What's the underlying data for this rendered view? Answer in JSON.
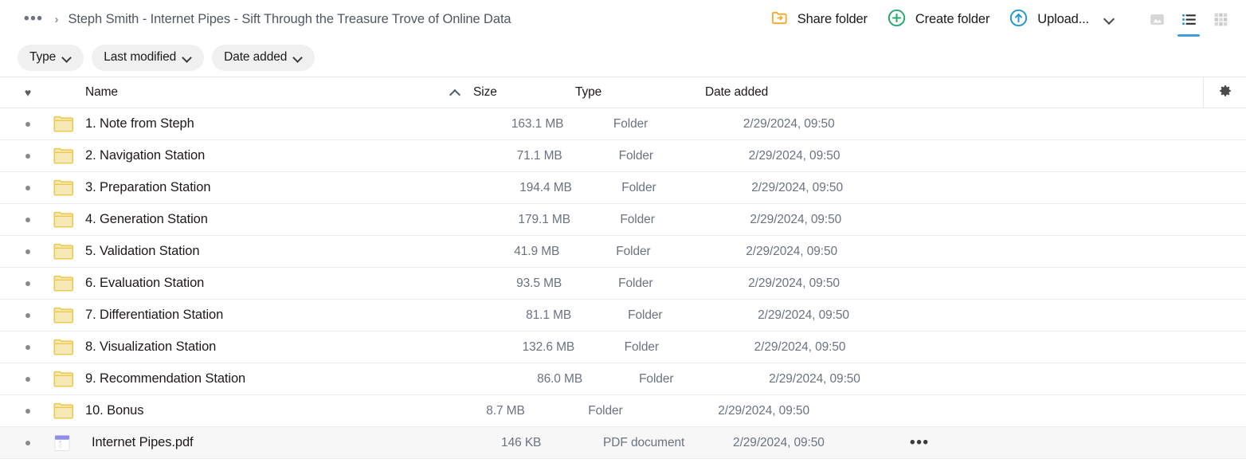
{
  "breadcrumb": {
    "ellipsis": "•••",
    "separator": "›",
    "title": "Steph Smith - Internet Pipes - Sift Through the Treasure Trove of Online Data"
  },
  "toolbar": {
    "share_folder_label": "Share folder",
    "share_folder_icon": "share-folder-icon",
    "create_folder_label": "Create folder",
    "create_folder_icon": "plus-circle-icon",
    "upload_label": "Upload...",
    "upload_icon": "upload-arrow-circle-icon",
    "upload_chevron_icon": "chevron-down-icon",
    "view_gallery_icon": "gallery-view-icon",
    "view_list_icon": "list-view-icon",
    "view_grid_icon": "grid-view-icon",
    "active_view": "list"
  },
  "filters": [
    {
      "label": "Type",
      "chevron_icon": "chevron-down-icon"
    },
    {
      "label": "Last modified",
      "chevron_icon": "chevron-down-icon"
    },
    {
      "label": "Date added",
      "chevron_icon": "chevron-down-icon"
    }
  ],
  "table": {
    "headers": {
      "favorite_icon": "heart-icon",
      "name": "Name",
      "sort_icon": "chevron-up-icon",
      "sort_direction": "ascending",
      "size": "Size",
      "type": "Type",
      "date_added": "Date added",
      "settings_icon": "gear-icon"
    },
    "rows": [
      {
        "bullet": "•",
        "icon": "folder-icon",
        "name": "1. Note from Steph",
        "size": "163.1 MB",
        "type": "Folder",
        "date_added": "2/29/2024, 09:50",
        "more": "",
        "hovered": false
      },
      {
        "bullet": "•",
        "icon": "folder-icon",
        "name": "2. Navigation Station",
        "size": "71.1 MB",
        "type": "Folder",
        "date_added": "2/29/2024, 09:50",
        "more": "",
        "hovered": false
      },
      {
        "bullet": "•",
        "icon": "folder-icon",
        "name": "3. Preparation Station",
        "size": "194.4 MB",
        "type": "Folder",
        "date_added": "2/29/2024, 09:50",
        "more": "",
        "hovered": false
      },
      {
        "bullet": "•",
        "icon": "folder-icon",
        "name": "4. Generation Station",
        "size": "179.1 MB",
        "type": "Folder",
        "date_added": "2/29/2024, 09:50",
        "more": "",
        "hovered": false
      },
      {
        "bullet": "•",
        "icon": "folder-icon",
        "name": "5. Validation Station",
        "size": "41.9 MB",
        "type": "Folder",
        "date_added": "2/29/2024, 09:50",
        "more": "",
        "hovered": false
      },
      {
        "bullet": "•",
        "icon": "folder-icon",
        "name": "6. Evaluation Station",
        "size": "93.5 MB",
        "type": "Folder",
        "date_added": "2/29/2024, 09:50",
        "more": "",
        "hovered": false
      },
      {
        "bullet": "•",
        "icon": "folder-icon",
        "name": "7. Differentiation Station",
        "size": "81.1 MB",
        "type": "Folder",
        "date_added": "2/29/2024, 09:50",
        "more": "",
        "hovered": false
      },
      {
        "bullet": "•",
        "icon": "folder-icon",
        "name": "8. Visualization Station",
        "size": "132.6 MB",
        "type": "Folder",
        "date_added": "2/29/2024, 09:50",
        "more": "",
        "hovered": false
      },
      {
        "bullet": "•",
        "icon": "folder-icon",
        "name": "9. Recommendation Station",
        "size": "86.0 MB",
        "type": "Folder",
        "date_added": "2/29/2024, 09:50",
        "more": "",
        "hovered": false
      },
      {
        "bullet": "•",
        "icon": "folder-icon",
        "name": "10. Bonus",
        "size": "8.7 MB",
        "type": "Folder",
        "date_added": "2/29/2024, 09:50",
        "more": "",
        "hovered": false
      },
      {
        "bullet": "•",
        "icon": "pdf-icon",
        "name": "Internet Pipes.pdf",
        "size": "146 KB",
        "type": "PDF document",
        "date_added": "2/29/2024, 09:50",
        "more": "•••",
        "hovered": true
      }
    ]
  },
  "colors": {
    "accent_blue": "#3f9cdc",
    "share_orange": "#f7a82a",
    "create_green": "#26a96c",
    "upload_blue": "#2196d8",
    "folder_yellow": "#eac84b",
    "folder_fill": "#f7e9b6",
    "pdf_purple": "#8f8fe8",
    "text_dark": "#1e1919",
    "text_muted": "#6b7280",
    "row_hover": "#f7f7f7"
  }
}
